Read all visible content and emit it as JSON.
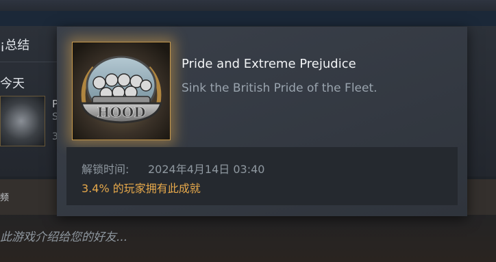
{
  "background": {
    "section_title": "¡总结",
    "today_label": "今天",
    "achievement_row": {
      "line1": "P",
      "line2": "S",
      "line3": "3"
    },
    "lower_small": "频",
    "recommend_text": "此游戏介绍给您的好友..."
  },
  "tooltip": {
    "achievement_icon": "hood-ship-crew-icon",
    "icon_text": "HOOD",
    "title": "Pride and Extreme Prejudice",
    "description": "Sink the British Pride of the Fleet.",
    "unlock_label": "解锁时间:",
    "unlock_time": "2024年4月14日 03:40",
    "rarity": "3.4% 的玩家拥有此成就"
  },
  "colors": {
    "rarity": "#e7a94b",
    "glow": "#e6aa46"
  }
}
